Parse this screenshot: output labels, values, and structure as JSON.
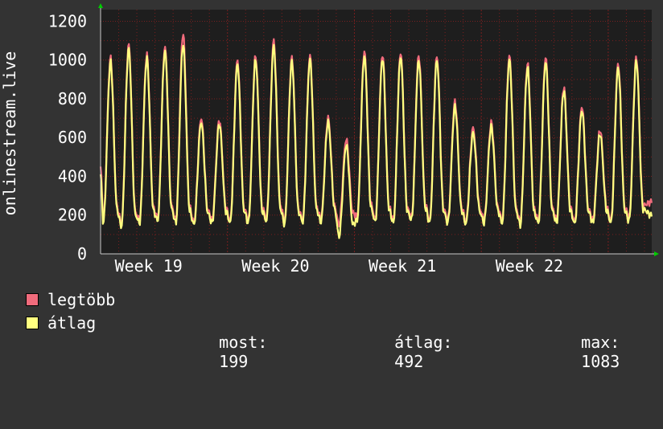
{
  "colors": {
    "background": "#333333",
    "plot_background": "#1e1e1e",
    "grid": "#7a1f1f",
    "axis": "#c8c8c8",
    "text": "#ffffff",
    "arrow": "#00cc00"
  },
  "chart_data": {
    "type": "line",
    "ylabel": "onlinestream.live",
    "ylim": [
      0,
      1260
    ],
    "yticks": [
      0,
      200,
      400,
      600,
      800,
      1000,
      1200
    ],
    "xticks": [
      {
        "label": "Week 19",
        "x": 2.65
      },
      {
        "label": "Week 20",
        "x": 9.65
      },
      {
        "label": "Week 21",
        "x": 16.65
      },
      {
        "label": "Week 22",
        "x": 23.65
      }
    ],
    "xlim": [
      0,
      30.4
    ],
    "x_unit": "days",
    "grid": true,
    "daily_cycles": {
      "x_peak_offset": 0.55,
      "trough_value": 180,
      "max_peaks": [
        1010,
        1080,
        1030,
        1070,
        1140,
        700,
        690,
        1000,
        1020,
        1100,
        1010,
        1020,
        700,
        590,
        1045,
        1030,
        1040,
        1025,
        1020,
        785,
        650,
        675,
        1020,
        980,
        1015,
        860,
        760,
        640,
        980,
        1015
      ],
      "avg_peaks": [
        990,
        1060,
        1010,
        1050,
        1083,
        680,
        670,
        980,
        1000,
        1070,
        990,
        1000,
        680,
        560,
        1020,
        1010,
        1020,
        1000,
        1000,
        760,
        625,
        655,
        1000,
        960,
        990,
        840,
        740,
        620,
        960,
        995
      ],
      "max_troughs": [
        175,
        155,
        175,
        185,
        175,
        165,
        175,
        175,
        175,
        190,
        170,
        180,
        180,
        150,
        195,
        180,
        175,
        190,
        175,
        175,
        170,
        175,
        175,
        165,
        175,
        175,
        170,
        175,
        175,
        190
      ],
      "avg_troughs": [
        160,
        140,
        160,
        170,
        160,
        150,
        160,
        160,
        160,
        170,
        155,
        165,
        165,
        90,
        175,
        165,
        160,
        175,
        160,
        160,
        155,
        160,
        160,
        150,
        160,
        160,
        155,
        160,
        160,
        170
      ],
      "start_value": 450,
      "end_value": 199
    },
    "series": [
      {
        "name": "legtöbb",
        "color": "#f06b7c",
        "key": "max"
      },
      {
        "name": "átlag",
        "color": "#ffff80",
        "key": "avg"
      }
    ]
  },
  "legend": {
    "items": [
      {
        "label": "legtöbb",
        "color": "#f06b7c"
      },
      {
        "label": "átlag",
        "color": "#ffff80"
      }
    ],
    "stats": [
      {
        "key": "most:",
        "value": "199"
      },
      {
        "key": "átlag:",
        "value": "492"
      },
      {
        "key": "max:",
        "value": "1083"
      }
    ]
  }
}
